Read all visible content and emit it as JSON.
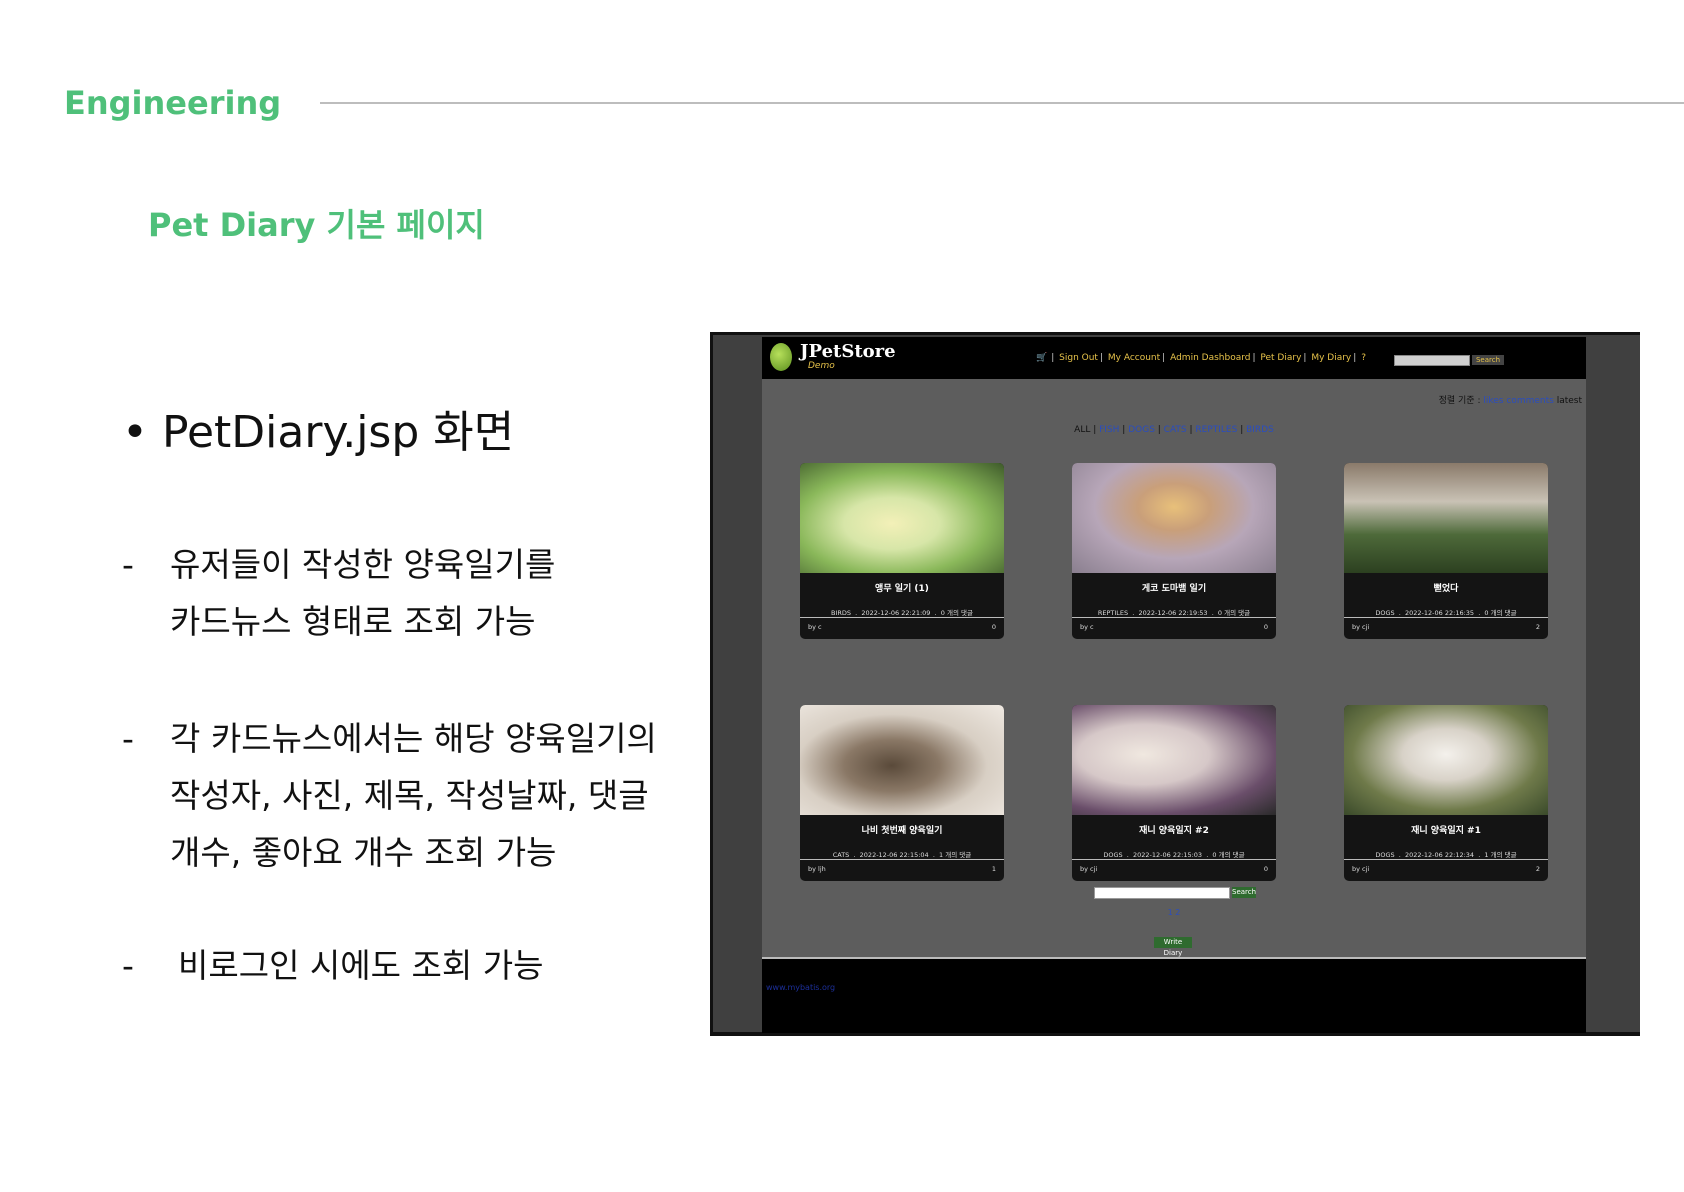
{
  "slide": {
    "section": "Engineering",
    "title": "Pet Diary 기본 페이지",
    "bullet": "PetDiary.jsp 화면",
    "descriptions": [
      {
        "dash": "-",
        "lines": [
          "유저들이 작성한 양육일기를",
          "카드뉴스 형태로 조회 가능"
        ]
      },
      {
        "dash": "-",
        "lines": [
          "각 카드뉴스에서는 해당 양육일기의",
          "작성자, 사진, 제목, 작성날짜, 댓글",
          "개수, 좋아요 개수 조회 가능"
        ]
      },
      {
        "dash": "-",
        "lines": [
          "비로그인 시에도 조회 가능"
        ]
      }
    ]
  },
  "app": {
    "logo": {
      "name": "JPetStore",
      "sub": "Demo"
    },
    "nav": [
      "Sign Out",
      "My Account",
      "Admin Dashboard",
      "Pet Diary",
      "My Diary",
      "?"
    ],
    "top_search_button": "Search",
    "sort": {
      "label": "정렬 기준 :",
      "options": [
        "likes",
        "comments",
        "latest"
      ]
    },
    "categories": [
      "ALL",
      "FISH",
      "DOGS",
      "CATS",
      "REPTILES",
      "BIRDS"
    ],
    "cards": [
      {
        "title": "앵무 일기 (1)",
        "category": "BIRDS",
        "date": "2022-12-06 22:21:09",
        "comments": "0 개의 댓글",
        "author": "by c",
        "likes": "0",
        "photo": "bird-photo"
      },
      {
        "title": "게코 도마뱀 일기",
        "category": "REPTILES",
        "date": "2022-12-06 22:19:53",
        "comments": "0 개의 댓글",
        "author": "by c",
        "likes": "0",
        "photo": "gecko-photo"
      },
      {
        "title": "뻗었다",
        "category": "DOGS",
        "date": "2022-12-06 22:16:35",
        "comments": "0 개의 댓글",
        "author": "by cji",
        "likes": "2",
        "photo": "dog-photo"
      },
      {
        "title": "나비 첫번째 양육일기",
        "category": "CATS",
        "date": "2022-12-06 22:15:04",
        "comments": "1 개의 댓글",
        "author": "by ljh",
        "likes": "1",
        "photo": "cat-photo"
      },
      {
        "title": "재니 양육일지 #2",
        "category": "DOGS",
        "date": "2022-12-06 22:15:03",
        "comments": "0 개의 댓글",
        "author": "by cji",
        "likes": "0",
        "photo": "dog-photo"
      },
      {
        "title": "재니 양육일지 #1",
        "category": "DOGS",
        "date": "2022-12-06 22:12:34",
        "comments": "1 개의 댓글",
        "author": "by cji",
        "likes": "2",
        "photo": "dog-photo"
      }
    ],
    "bottom_search_button": "Search",
    "pages": "1 2",
    "write_button": "Write Diary",
    "footer_link": "www.mybatis.org"
  }
}
